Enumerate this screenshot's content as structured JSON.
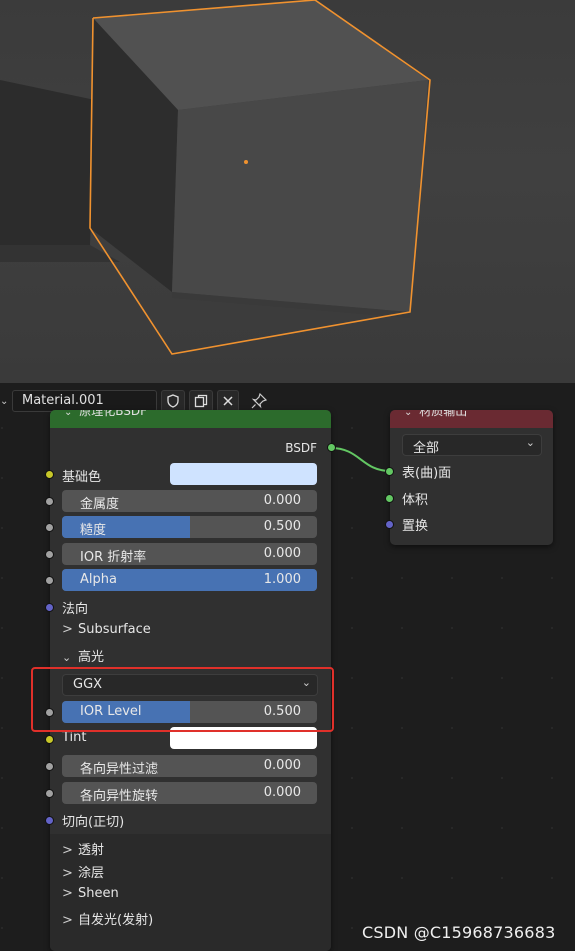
{
  "header": {
    "material_name": "Material.001",
    "icons": [
      "shield-icon",
      "duplicate-icon",
      "close-icon",
      "pin-icon"
    ]
  },
  "bsdf_node": {
    "title": "原理化BSDF",
    "output_label": "BSDF",
    "base_color_label": "基础色",
    "base_color": "#cfe3ff",
    "metallic": {
      "label": "金属度",
      "value": "0.000",
      "fraction": 0
    },
    "roughness": {
      "label": "糙度",
      "value": "0.500",
      "fraction": 0.5
    },
    "ior": {
      "label": "IOR 折射率",
      "value": "0.000",
      "fraction": 0
    },
    "alpha": {
      "label": "Alpha",
      "value": "1.000",
      "fraction": 1
    },
    "normal_label": "法向",
    "subsurface_label": "Subsurface",
    "specular_label": "高光",
    "distribution": "GGX",
    "ior_level": {
      "label": "IOR Level",
      "value": "0.500",
      "fraction": 0.5
    },
    "tint_label": "Tint",
    "tint_color": "#ffffff",
    "anisotropic": {
      "label": "各向异性过滤",
      "value": "0.000",
      "fraction": 0
    },
    "anisotropic_rotation": {
      "label": "各向异性旋转",
      "value": "0.000",
      "fraction": 0
    },
    "tangent_label": "切向(正切)",
    "panels": [
      "透射",
      "涂层",
      "Sheen",
      "自发光(发射)"
    ]
  },
  "output_node": {
    "title": "材质输出",
    "target": "全部",
    "inputs": [
      "表(曲)面",
      "体积",
      "置换"
    ]
  },
  "colors": {
    "shader_header": "#2c6b2c",
    "output_header": "#6a2a32",
    "socket_color": "#c7c729",
    "socket_float": "#a1a1a1",
    "socket_vector": "#6363c7",
    "socket_shader": "#63c763",
    "selection": "#f0922f",
    "highlight_box": "#e0302a"
  },
  "watermark": "CSDN @C15968736683"
}
